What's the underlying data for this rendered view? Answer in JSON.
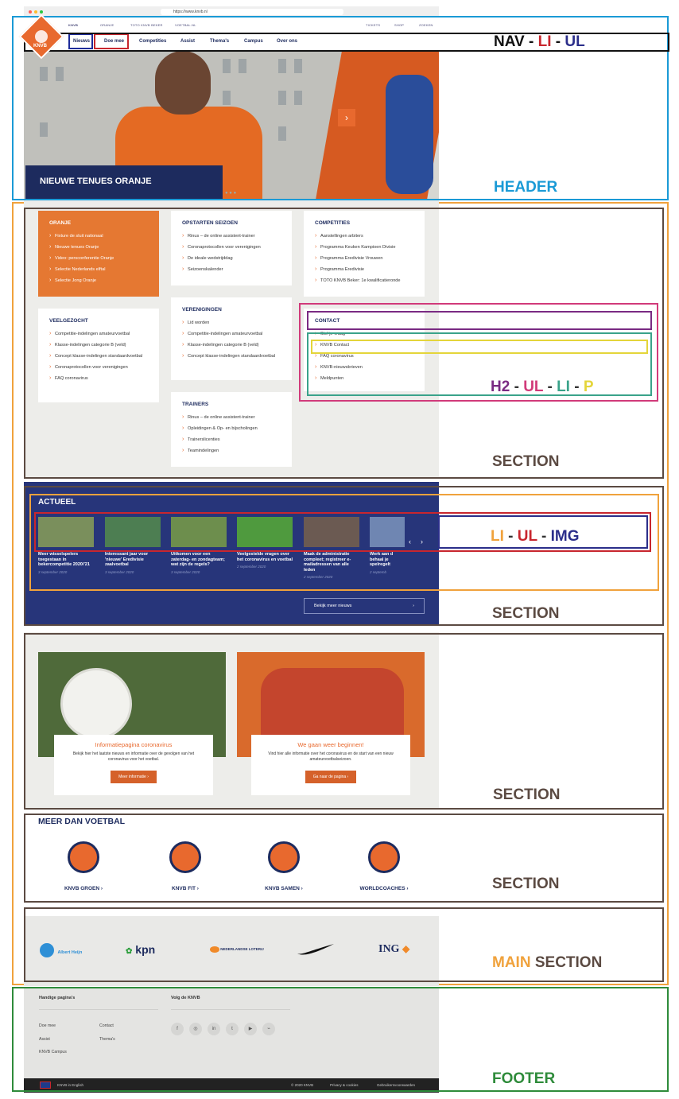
{
  "browser": {
    "url": "https://www.knvb.nl"
  },
  "topbar": {
    "items": [
      "KNVB",
      "ORANJE",
      "TOTO KNVB BEKER",
      "VOETBAL.NL"
    ],
    "right": [
      "TICKETS",
      "SHOP",
      "ZOEKEN"
    ]
  },
  "logo": {
    "text": "KNVB"
  },
  "nav": {
    "items": [
      "Nieuws",
      "Doe mee",
      "Competities",
      "Assist",
      "Thema's",
      "Campus",
      "Over ons"
    ]
  },
  "hero": {
    "caption": "NIEUWE TENUES ORANJE",
    "next": "›",
    "dots": "● ● ●"
  },
  "annotations": {
    "nav": "NAV - LI - UL",
    "nav_a": "NAV -",
    "nav_b": "LI",
    "nav_c": "-",
    "nav_d": "UL",
    "header": "HEADER",
    "h2_a": "H2",
    "h2_b": "-",
    "h2_c": "UL",
    "h2_d": "-",
    "h2_e": "LI",
    "h2_f": "-",
    "h2_g": "P",
    "section": "SECTION",
    "li_a": "LI",
    "li_b": "-",
    "li_c": "UL",
    "li_d": "-",
    "li_e": "IMG",
    "main_a": "MAIN",
    "main_b": "SECTION",
    "footer": "FOOTER"
  },
  "section1": {
    "badge": "Actueel",
    "oranje": {
      "title": "ORANJE",
      "items": [
        "Fixture de sluit nationaal",
        "Nieuwe tenues Oranje",
        "Video: persconferentie Oranje",
        "Selectie Nederlands elftal",
        "Selectie Jong Oranje"
      ]
    },
    "opstarten": {
      "title": "OPSTARTEN SEIZOEN",
      "items": [
        "Rinus – de online assistent-trainer",
        "Coronaprotocollen voor verenigingen",
        "De ideale wedstrijddag",
        "Seizoenskalender"
      ]
    },
    "competities": {
      "title": "COMPETITIES",
      "items": [
        "Aanstellingen arbiters",
        "Programma Keuken Kampioen Divisie",
        "Programma Eredivisie Vrouwen",
        "Programma Eredivisie",
        "TOTO KNVB Beker: 1e kwalificatieronde"
      ]
    },
    "veelgezocht": {
      "title": "VEELGEZOCHT",
      "items": [
        "Competitie-indelingen amateurvoetbal",
        "Klasse-indelingen categorie B (veld)",
        "Concept klasse-indelingen standaardvoetbal",
        "Coronaprotocollen voor verenigingen",
        "FAQ coronavirus"
      ]
    },
    "verenigingen": {
      "title": "VERENIGINGEN",
      "items": [
        "Lid worden",
        "Competitie-indelingen amateurvoetbal",
        "Klasse-indelingen categorie B (veld)",
        "Concept klasse-indelingen standaardvoetbal"
      ]
    },
    "contact": {
      "title": "CONTACT",
      "items": [
        "Stel je vraag",
        "KNVB Contact",
        "FAQ coronavirus",
        "KNVB-nieuwsbrieven",
        "Meldpunten"
      ]
    },
    "trainers": {
      "title": "TRAINERS",
      "items": [
        "Rinus – de online assistent-trainer",
        "Opleidingen & Op- en bijscholingen",
        "Trainerslicenties",
        "Teamindelingen"
      ]
    }
  },
  "actueel": {
    "title": "ACTUEEL",
    "items": [
      {
        "title": "Meer wisselspelers toegestaan in bekercompetitie 2020/'21",
        "date": "3 september 2020"
      },
      {
        "title": "Interessant jaar voor 'nieuwe' Eredivisie zaalvoetbal",
        "date": "3 september 2020"
      },
      {
        "title": "Uitkomen voor een zaterdag- en zondagteam; wat zijn de regels?",
        "date": "3 september 2020"
      },
      {
        "title": "Veelgestelde vragen over het coronavirus en voetbal",
        "date": "2 september 2020"
      },
      {
        "title": "Maak de administratie compleet; registreer e-mailadressen van alle leden",
        "date": "2 september 2020"
      },
      {
        "title": "Werk aan d behaal je spelregelt",
        "date": "2 septemb"
      }
    ],
    "prev": "‹",
    "next": "›",
    "more": "Bekijk meer nieuws",
    "more_arrow": "›"
  },
  "info": {
    "corona": {
      "title": "Informatiepagina coronavirus",
      "text": "Bekijk hier het laatste nieuws en informatie over de gevolgen van het coronavirus voor het voetbal.",
      "button": "Meer informatie  ›"
    },
    "restart": {
      "title": "We gaan weer beginnen!",
      "text": "Vind hier alle informatie over het coronavirus en de start van een nieuw amateurvoetbalseizoen.",
      "button": "Ga naar de pagina  ›"
    }
  },
  "meer": {
    "title": "MEER DAN VOETBAL",
    "items": [
      "KNVB GROEN  ›",
      "KNVB FIT  ›",
      "KNVB SAMEN  ›",
      "WORLDCOACHES  ›"
    ]
  },
  "sponsors": {
    "ah": "Albert Heijn",
    "kpn": "kpn",
    "loterij": "NEDERLANDSE LOTERIJ",
    "ing": "ING"
  },
  "footer": {
    "handige": "Handige pagina's",
    "volg": "Volg de KNVB",
    "links": [
      "Doe mee",
      "Assist",
      "KNVB Campus",
      "Contact",
      "Thema's"
    ],
    "social": [
      "f",
      "◎",
      "in",
      "t",
      "▶",
      "⌁"
    ],
    "english": "KNVB in English",
    "copyright": "© 2020 KNVB",
    "privacy": "Privacy & cookies",
    "terms": "Gebruikersvoorwaarden"
  },
  "colors": {
    "navy": "#1d2b5e",
    "orange": "#e8692e",
    "header_box": "#1a9ad6",
    "main_box": "#f0a23c",
    "section_box": "#5b4a42",
    "footer_box": "#2e8b3a"
  }
}
